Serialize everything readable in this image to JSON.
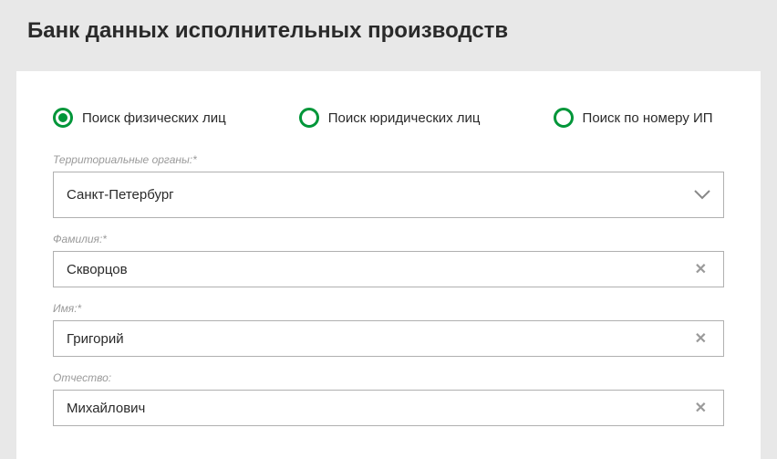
{
  "header": {
    "title": "Банк данных исполнительных производств"
  },
  "search_type": {
    "options": [
      {
        "label": "Поиск физических лиц",
        "selected": true
      },
      {
        "label": "Поиск юридических лиц",
        "selected": false
      },
      {
        "label": "Поиск по номеру ИП",
        "selected": false
      }
    ]
  },
  "fields": {
    "territory": {
      "label": "Территориальные органы:*",
      "value": "Санкт-Петербург"
    },
    "lastname": {
      "label": "Фамилия:*",
      "value": "Скворцов"
    },
    "firstname": {
      "label": "Имя:*",
      "value": "Григорий"
    },
    "patronymic": {
      "label": "Отчество:",
      "value": "Михайлович"
    }
  }
}
